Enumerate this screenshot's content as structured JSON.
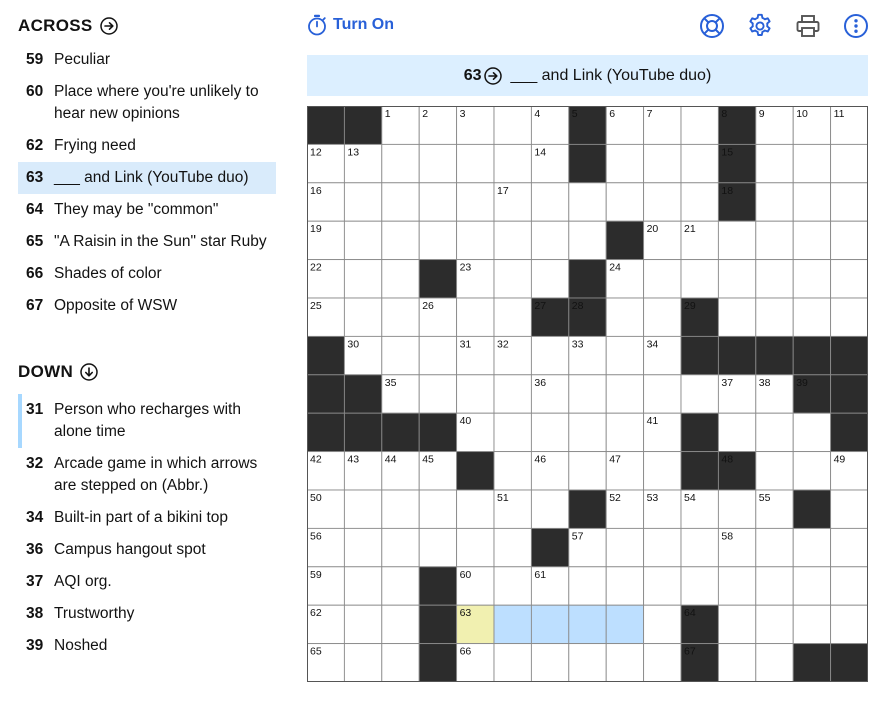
{
  "across": {
    "title": "ACROSS",
    "clues": [
      {
        "num": "59",
        "text": "Peculiar"
      },
      {
        "num": "60",
        "text": "Place where you're unlikely to hear new opinions"
      },
      {
        "num": "62",
        "text": "Frying need"
      },
      {
        "num": "63",
        "text": "___ and Link (YouTube duo)",
        "state": "active"
      },
      {
        "num": "64",
        "text": "They may be \"common\""
      },
      {
        "num": "65",
        "text": "\"A Raisin in the Sun\" star Ruby"
      },
      {
        "num": "66",
        "text": "Shades of color"
      },
      {
        "num": "67",
        "text": "Opposite of WSW"
      }
    ]
  },
  "down": {
    "title": "DOWN",
    "clues": [
      {
        "num": "31",
        "text": "Person who recharges with alone time",
        "state": "cross"
      },
      {
        "num": "32",
        "text": "Arcade game in which arrows are stepped on (Abbr.)"
      },
      {
        "num": "34",
        "text": "Built-in part of a bikini top"
      },
      {
        "num": "36",
        "text": "Campus hangout spot"
      },
      {
        "num": "37",
        "text": "AQI org."
      },
      {
        "num": "38",
        "text": "Trustworthy"
      },
      {
        "num": "39",
        "text": "Noshed"
      }
    ]
  },
  "toolbar": {
    "timer_label": "Turn On",
    "buttons": [
      {
        "name": "help-button",
        "icon": "lifebuoy-icon"
      },
      {
        "name": "settings-button",
        "icon": "gear-icon"
      },
      {
        "name": "print-button",
        "icon": "printer-icon"
      },
      {
        "name": "more-button",
        "icon": "more-vertical-icon"
      }
    ]
  },
  "clue_bar": {
    "num": "63",
    "text": "___ and Link (YouTube duo)"
  },
  "colors": {
    "accent": "#2860d8",
    "active_clue_bg": "#d9ebfb",
    "clue_bar_bg": "#dcefff",
    "selected_cell": "#f1f0b0",
    "word_highlight": "#bddfff",
    "block": "#2c2c2c"
  },
  "grid": {
    "rows": 15,
    "cols": 15,
    "layout": [
      "##.....#...#...",
      ".......#...#...",
      "...........#...",
      "........#......",
      "...#...#.......",
      "......##..#....",
      "#.........#####",
      "##...........##",
      "####......#...#",
      "....#.....##...",
      ".......#.....#.",
      "......#........",
      "...#...........",
      "...#......#....",
      "...#......#..##"
    ],
    "numbers": [
      {
        "r": 0,
        "c": 2,
        "n": "1"
      },
      {
        "r": 0,
        "c": 3,
        "n": "2"
      },
      {
        "r": 0,
        "c": 4,
        "n": "3"
      },
      {
        "r": 0,
        "c": 6,
        "n": "4"
      },
      {
        "r": 0,
        "c": 7,
        "n": "5"
      },
      {
        "r": 0,
        "c": 8,
        "n": "6"
      },
      {
        "r": 0,
        "c": 9,
        "n": "7"
      },
      {
        "r": 0,
        "c": 11,
        "n": "8"
      },
      {
        "r": 0,
        "c": 12,
        "n": "9"
      },
      {
        "r": 0,
        "c": 13,
        "n": "10"
      },
      {
        "r": 0,
        "c": 14,
        "n": "11"
      },
      {
        "r": 1,
        "c": 0,
        "n": "12"
      },
      {
        "r": 1,
        "c": 1,
        "n": "13"
      },
      {
        "r": 1,
        "c": 6,
        "n": "14"
      },
      {
        "r": 1,
        "c": 11,
        "n": "15"
      },
      {
        "r": 2,
        "c": 0,
        "n": "16"
      },
      {
        "r": 2,
        "c": 5,
        "n": "17"
      },
      {
        "r": 2,
        "c": 11,
        "n": "18"
      },
      {
        "r": 3,
        "c": 0,
        "n": "19"
      },
      {
        "r": 3,
        "c": 9,
        "n": "20"
      },
      {
        "r": 3,
        "c": 10,
        "n": "21"
      },
      {
        "r": 4,
        "c": 0,
        "n": "22"
      },
      {
        "r": 4,
        "c": 4,
        "n": "23"
      },
      {
        "r": 4,
        "c": 8,
        "n": "24"
      },
      {
        "r": 5,
        "c": 0,
        "n": "25"
      },
      {
        "r": 5,
        "c": 3,
        "n": "26"
      },
      {
        "r": 5,
        "c": 6,
        "n": "27"
      },
      {
        "r": 5,
        "c": 7,
        "n": "28"
      },
      {
        "r": 5,
        "c": 10,
        "n": "29"
      },
      {
        "r": 6,
        "c": 1,
        "n": "30"
      },
      {
        "r": 6,
        "c": 4,
        "n": "31"
      },
      {
        "r": 6,
        "c": 5,
        "n": "32"
      },
      {
        "r": 6,
        "c": 7,
        "n": "33"
      },
      {
        "r": 6,
        "c": 9,
        "n": "34"
      },
      {
        "r": 7,
        "c": 2,
        "n": "35"
      },
      {
        "r": 7,
        "c": 6,
        "n": "36"
      },
      {
        "r": 7,
        "c": 11,
        "n": "37"
      },
      {
        "r": 7,
        "c": 12,
        "n": "38"
      },
      {
        "r": 7,
        "c": 13,
        "n": "39"
      },
      {
        "r": 8,
        "c": 4,
        "n": "40"
      },
      {
        "r": 8,
        "c": 9,
        "n": "41"
      },
      {
        "r": 9,
        "c": 0,
        "n": "42"
      },
      {
        "r": 9,
        "c": 1,
        "n": "43"
      },
      {
        "r": 9,
        "c": 2,
        "n": "44"
      },
      {
        "r": 9,
        "c": 3,
        "n": "45"
      },
      {
        "r": 9,
        "c": 6,
        "n": "46"
      },
      {
        "r": 9,
        "c": 8,
        "n": "47"
      },
      {
        "r": 9,
        "c": 11,
        "n": "48"
      },
      {
        "r": 9,
        "c": 14,
        "n": "49"
      },
      {
        "r": 10,
        "c": 0,
        "n": "50"
      },
      {
        "r": 10,
        "c": 5,
        "n": "51"
      },
      {
        "r": 10,
        "c": 8,
        "n": "52"
      },
      {
        "r": 10,
        "c": 9,
        "n": "53"
      },
      {
        "r": 10,
        "c": 10,
        "n": "54"
      },
      {
        "r": 10,
        "c": 12,
        "n": "55"
      },
      {
        "r": 11,
        "c": 0,
        "n": "56"
      },
      {
        "r": 11,
        "c": 7,
        "n": "57"
      },
      {
        "r": 11,
        "c": 11,
        "n": "58"
      },
      {
        "r": 12,
        "c": 0,
        "n": "59"
      },
      {
        "r": 12,
        "c": 4,
        "n": "60"
      },
      {
        "r": 12,
        "c": 6,
        "n": "61"
      },
      {
        "r": 13,
        "c": 0,
        "n": "62"
      },
      {
        "r": 13,
        "c": 4,
        "n": "63"
      },
      {
        "r": 13,
        "c": 10,
        "n": "64"
      },
      {
        "r": 14,
        "c": 0,
        "n": "65"
      },
      {
        "r": 14,
        "c": 4,
        "n": "66"
      },
      {
        "r": 14,
        "c": 10,
        "n": "67"
      }
    ],
    "selected": {
      "r": 13,
      "c": 4
    },
    "highlight": {
      "r": 13,
      "from": 5,
      "to": 8
    }
  }
}
